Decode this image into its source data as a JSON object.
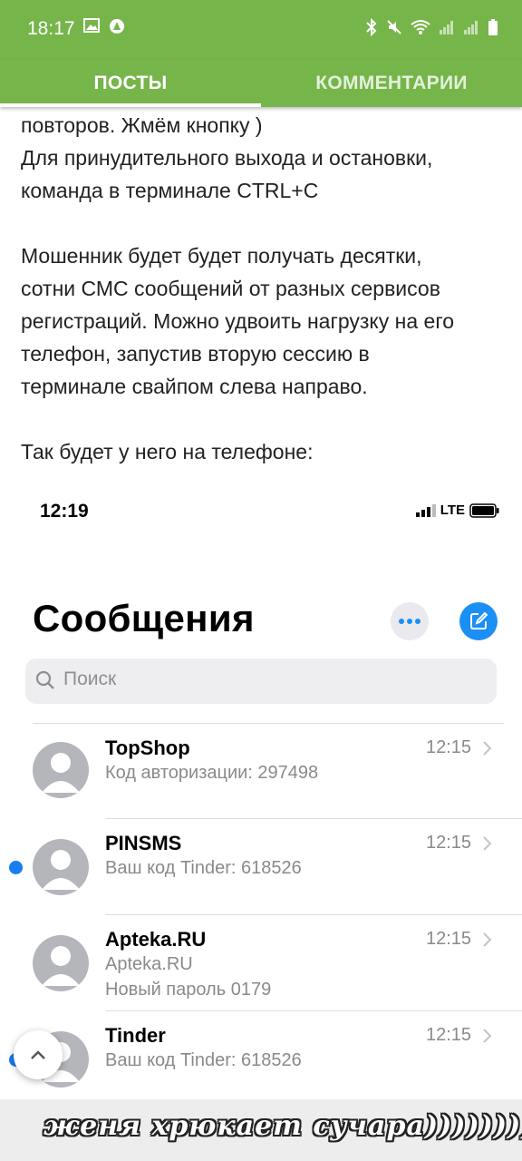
{
  "status_bar": {
    "time": "18:17"
  },
  "tabs": [
    {
      "label": "ПОСТЫ",
      "active": true
    },
    {
      "label": "КОММЕНТАРИИ",
      "active": false
    }
  ],
  "post": {
    "lines_1": [
      "повторов. Жмём кнопку )",
      "Для принудительного выхода и остановки,",
      "команда в терминале CTRL+C"
    ],
    "lines_2": [
      "Мошенник будет будет получать десятки,",
      "сотни СМС сообщений от разных сервисов",
      "регистраций. Можно удвоить нагрузку на его",
      "телефон, запустив вторую сессию в",
      "терминале свайпом слева направо."
    ],
    "lines_3": [
      "Так будет у него на телефоне:"
    ]
  },
  "screenshot": {
    "time": "12:19",
    "network": "LTE",
    "title": "Сообщения",
    "search_placeholder": "Поиск",
    "messages": [
      {
        "sender": "TopShop",
        "line1": "Код авторизации: 297498",
        "line2": "",
        "time": "12:15",
        "unread": false
      },
      {
        "sender": "PINSMS",
        "line1": "Ваш код Tinder: 618526",
        "line2": "",
        "time": "12:15",
        "unread": true
      },
      {
        "sender": "Apteka.RU",
        "line1": "Apteka.RU",
        "line2": "Новый пароль 0179",
        "time": "12:15",
        "unread": false
      },
      {
        "sender": "Tinder",
        "line1": "Ваш код Tinder: 618526",
        "line2": "",
        "time": "12:15",
        "unread": true
      }
    ]
  },
  "banner_text": "женя хрюкает сучара))))))))",
  "colors": {
    "header_green": "#76b54a",
    "ios_blue": "#1a8ff5"
  }
}
